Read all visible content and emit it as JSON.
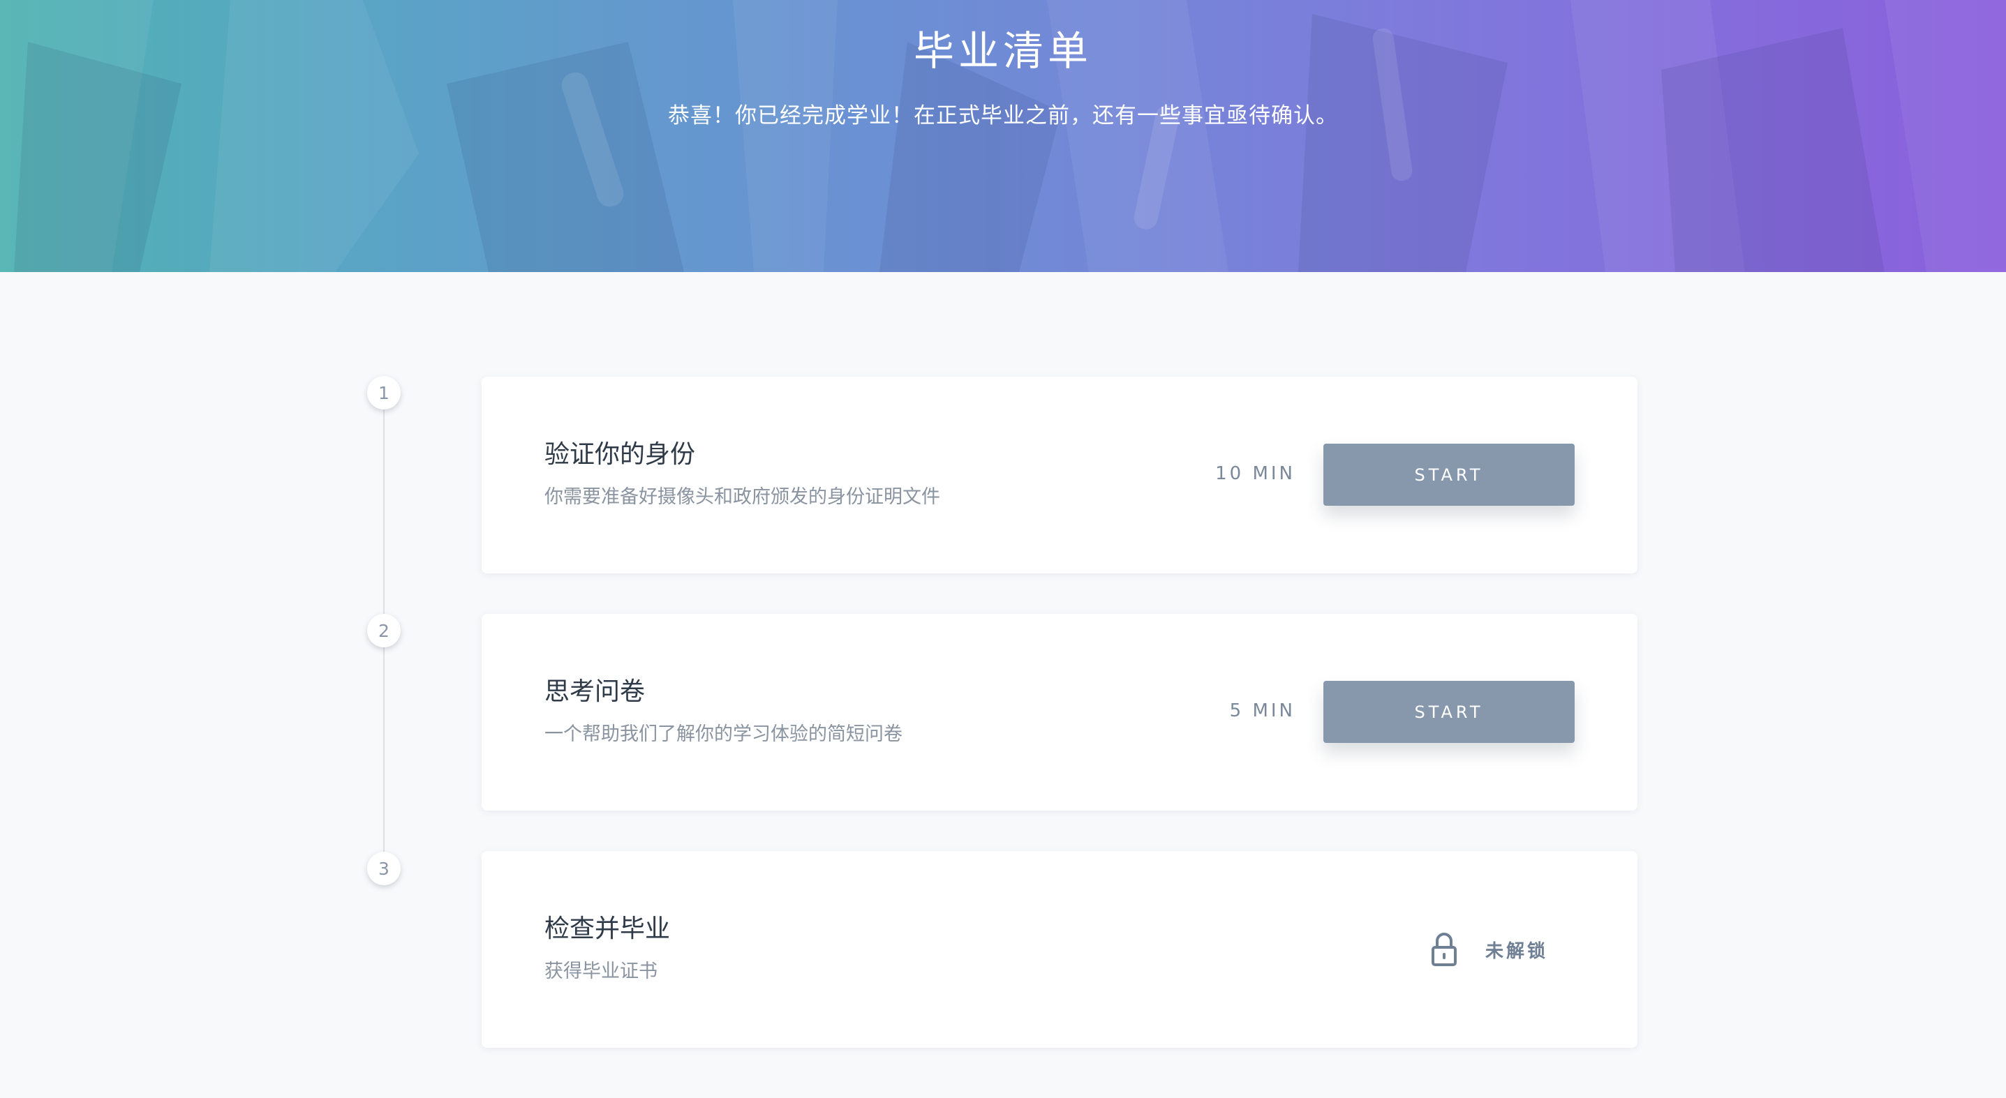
{
  "header": {
    "title": "毕业清单",
    "subtitle": "恭喜！你已经完成学业！在正式毕业之前，还有一些事宜亟待确认。"
  },
  "steps": [
    {
      "number": "1",
      "title": "验证你的身份",
      "description": "你需要准备好摄像头和政府颁发的身份证明文件",
      "duration": "10 MIN",
      "button_label": "START"
    },
    {
      "number": "2",
      "title": "思考问卷",
      "description": "一个帮助我们了解你的学习体验的简短问卷",
      "duration": "5 MIN",
      "button_label": "START"
    },
    {
      "number": "3",
      "title": "检查并毕业",
      "description": "获得毕业证书",
      "status_label": "未解锁",
      "status_icon": "lock-icon"
    }
  ],
  "colors": {
    "hero_gradient_start": "#4fb3b1",
    "hero_gradient_end": "#8b5fdc",
    "button_background": "#8798ad",
    "title_text": "#2f3a48",
    "muted_text": "#8a93a0"
  }
}
